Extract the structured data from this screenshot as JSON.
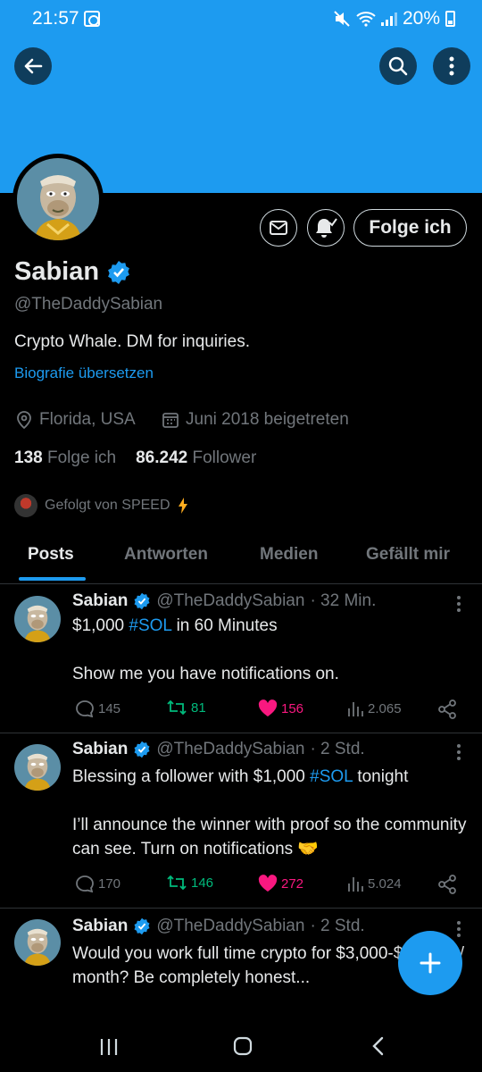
{
  "status_bar": {
    "time": "21:57",
    "battery": "20%"
  },
  "profile": {
    "name": "Sabian",
    "handle": "@TheDaddySabian",
    "bio": "Crypto Whale. DM for inquiries.",
    "translate_label": "Biografie übersetzen",
    "location": "Florida, USA",
    "joined": "Juni 2018 beigetreten",
    "following_count": "138",
    "following_label": "Folge ich",
    "followers_count": "86.242",
    "followers_label": "Follower",
    "followed_by": "Gefolgt von SPEED",
    "follow_button": "Folge ich"
  },
  "tabs": [
    {
      "label": "Posts",
      "active": true
    },
    {
      "label": "Antworten",
      "active": false
    },
    {
      "label": "Medien",
      "active": false
    },
    {
      "label": "Gefällt mir",
      "active": false
    }
  ],
  "tweets": [
    {
      "name": "Sabian",
      "handle": "@TheDaddySabian",
      "time": "· 32 Min.",
      "text_pre": "$1,000 ",
      "hashtag": "#SOL",
      "text_post": " in 60 Minutes\n\nShow me you have notifications on.",
      "replies": "145",
      "retweets": "81",
      "likes": "156",
      "views": "2.065"
    },
    {
      "name": "Sabian",
      "handle": "@TheDaddySabian",
      "time": "· 2 Std.",
      "text_pre": "Blessing a follower with $1,000 ",
      "hashtag": "#SOL",
      "text_post": " tonight\n\nI’ll announce the winner with proof so the community can see. Turn on notifications 🤝",
      "replies": "170",
      "retweets": "146",
      "likes": "272",
      "views": "5.024"
    },
    {
      "name": "Sabian",
      "handle": "@TheDaddySabian",
      "time": "· 2 Std.",
      "text_pre": "Would you work full time crypto for $3,000-$10,000 / month? Be completely honest...",
      "hashtag": "",
      "text_post": ""
    }
  ],
  "colors": {
    "accent": "#1d9bf0",
    "retweet": "#00ba7c",
    "like": "#f91880",
    "muted": "#71767b"
  }
}
